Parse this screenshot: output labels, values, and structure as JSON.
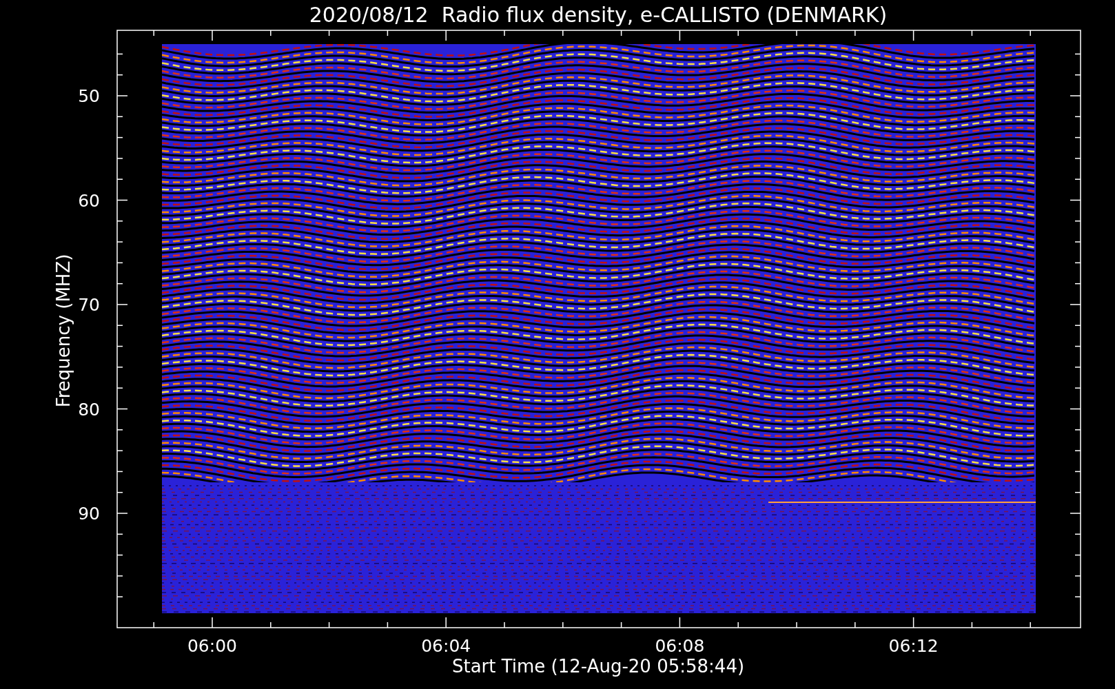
{
  "plot": {
    "title": "2020/08/12  Radio flux density, e-CALLISTO (DENMARK)",
    "ylabel": "Frequency (MHZ)",
    "xlabel": "Start Time (12-Aug-20 05:58:44)",
    "yticks": [
      "50",
      "60",
      "70",
      "80",
      "90"
    ],
    "xticks": [
      "06:00",
      "06:04",
      "06:08",
      "06:12"
    ]
  }
}
